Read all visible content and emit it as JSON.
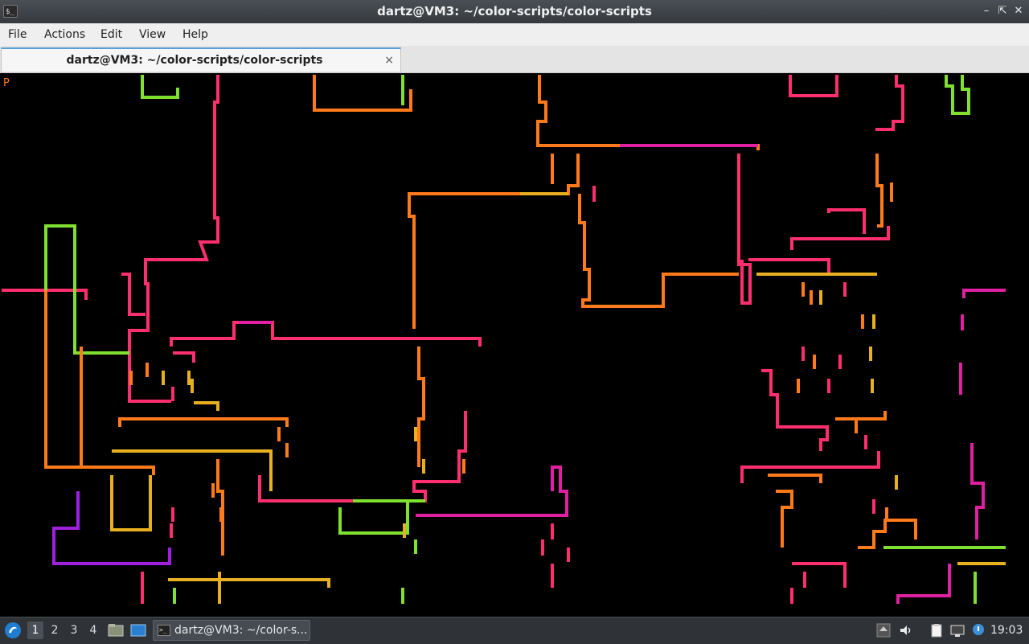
{
  "window": {
    "title": "dartz@VM3: ~/color-scripts/color-scripts",
    "app_icon": "terminal-icon",
    "controls": [
      "minimize-icon",
      "maximize-icon",
      "close-icon"
    ]
  },
  "menu": {
    "items": [
      "File",
      "Actions",
      "Edit",
      "View",
      "Help"
    ]
  },
  "tabs": [
    {
      "label": "dartz@VM3: ~/color-scripts/color-scripts",
      "close_glyph": "×"
    }
  ],
  "terminal": {
    "prompt_text": "P",
    "background": "#000000",
    "art_colors": [
      "#ff2e6e",
      "#ff7a1a",
      "#e8b020",
      "#80e030",
      "#e020a0",
      "#c020c0",
      "#a020e0"
    ]
  },
  "taskbar": {
    "start_icon": "lxqt-start-icon",
    "workspaces": [
      "1",
      "2",
      "3",
      "4"
    ],
    "active_workspace": "1",
    "quicklaunch": [
      "file-manager-icon",
      "show-desktop-icon"
    ],
    "task_label": "dartz@VM3: ~/color-s...",
    "tray": [
      "upload-icon",
      "volume-icon",
      "clipboard-icon",
      "network-icon",
      "notification-icon"
    ],
    "clock": "19:03"
  }
}
